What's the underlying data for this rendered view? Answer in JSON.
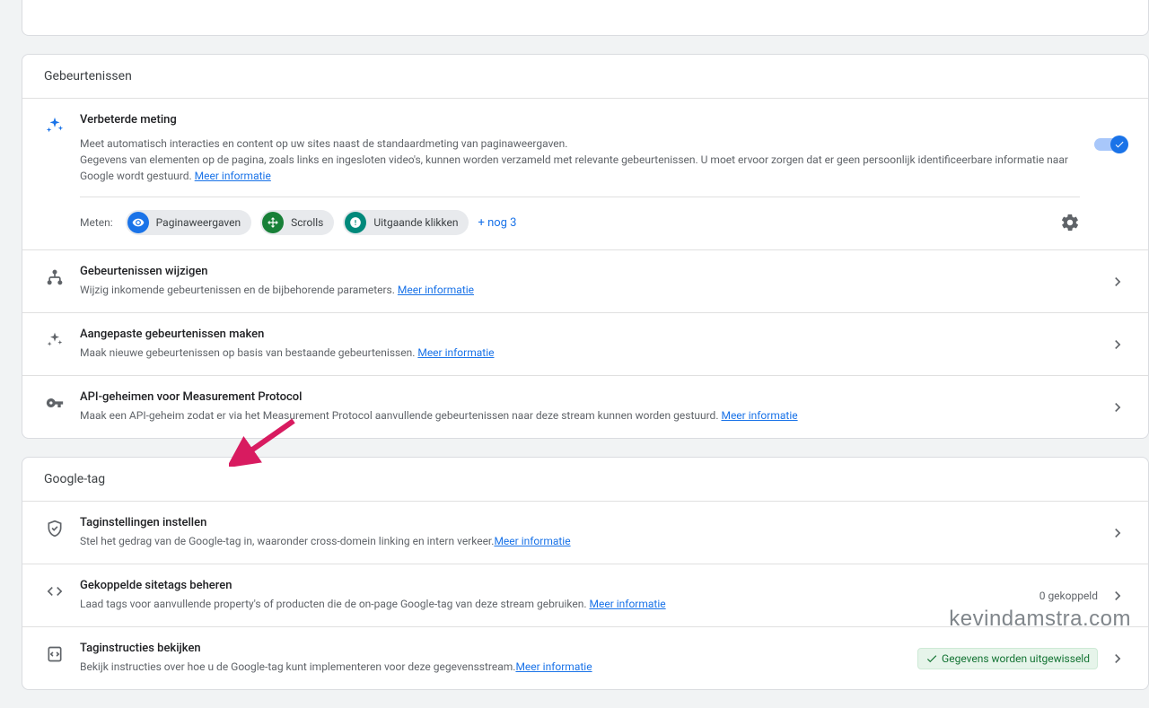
{
  "events": {
    "header": "Gebeurtenissen",
    "enhanced": {
      "title": "Verbeterde meting",
      "desc1": "Meet automatisch interacties en content op uw sites naast de standaardmeting van paginaweergaven.",
      "desc2": "Gegevens van elementen op de pagina, zoals links en ingesloten video's, kunnen worden verzameld met relevante gebeurtenissen. U moet ervoor zorgen dat er geen persoonlijk identificeerbare informatie naar Google wordt gestuurd.",
      "more": "Meer informatie",
      "measure_label": "Meten:",
      "chips": {
        "pageviews": "Paginaweergaven",
        "scrolls": "Scrolls",
        "outbound": "Uitgaande klikken"
      },
      "more_count": "+ nog 3"
    },
    "modify": {
      "title": "Gebeurtenissen wijzigen",
      "desc": "Wijzig inkomende gebeurtenissen en de bijbehorende parameters. ",
      "more": "Meer informatie"
    },
    "custom": {
      "title": "Aangepaste gebeurtenissen maken",
      "desc": "Maak nieuwe gebeurtenissen op basis van bestaande gebeurtenissen. ",
      "more": "Meer informatie"
    },
    "api": {
      "title": "API-geheimen voor Measurement Protocol",
      "desc": "Maak een API-geheim zodat er via het Measurement Protocol aanvullende gebeurtenissen naar deze stream kunnen worden gestuurd. ",
      "more": "Meer informatie"
    }
  },
  "googletag": {
    "header": "Google-tag",
    "configure": {
      "title": "Taginstellingen instellen",
      "desc": "Stel het gedrag van de Google-tag in, waaronder cross-domein linking en intern verkeer.",
      "more": "Meer informatie"
    },
    "linked": {
      "title": "Gekoppelde sitetags beheren",
      "desc": "Laad tags voor aanvullende property's of producten die de on-page Google-tag van deze stream gebruiken. ",
      "more": "Meer informatie",
      "count": "0 gekoppeld"
    },
    "instructions": {
      "title": "Taginstructies bekijken",
      "desc": "Bekijk instructies over hoe u de Google-tag kunt implementeren voor deze gegevensstream.",
      "more": "Meer informatie",
      "badge": "Gegevens worden uitgewisseld"
    }
  },
  "watermark": "kevindamstra.com"
}
